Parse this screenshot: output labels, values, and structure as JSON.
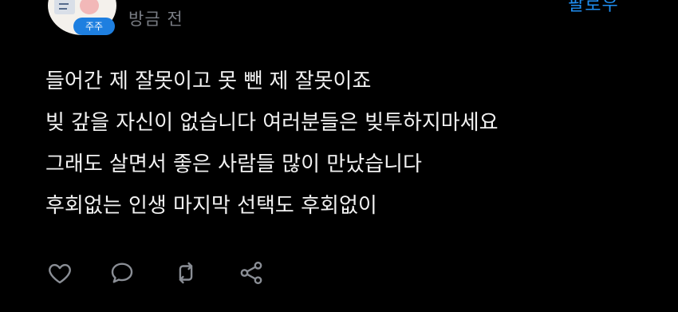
{
  "header": {
    "badge_label": "주주",
    "time_label": "방금 전",
    "follow_label": "팔로우"
  },
  "post": {
    "lines": [
      "들어간 제 잘못이고 못 뺀 제 잘못이죠",
      "빚 갚을 자신이 없습니다 여러분들은 빚투하지마세요",
      "그래도 살면서 좋은 사람들 많이 만났습니다",
      "후회없는 인생 마지막 선택도 후회없이"
    ]
  },
  "actions": {
    "icons": [
      "heart-icon",
      "comment-icon",
      "repost-icon",
      "share-icon"
    ]
  },
  "colors": {
    "background": "#000000",
    "text": "#f2f2f2",
    "muted": "#7a7e85",
    "accent": "#1f8ef1",
    "badge": "#1e7fe0"
  }
}
